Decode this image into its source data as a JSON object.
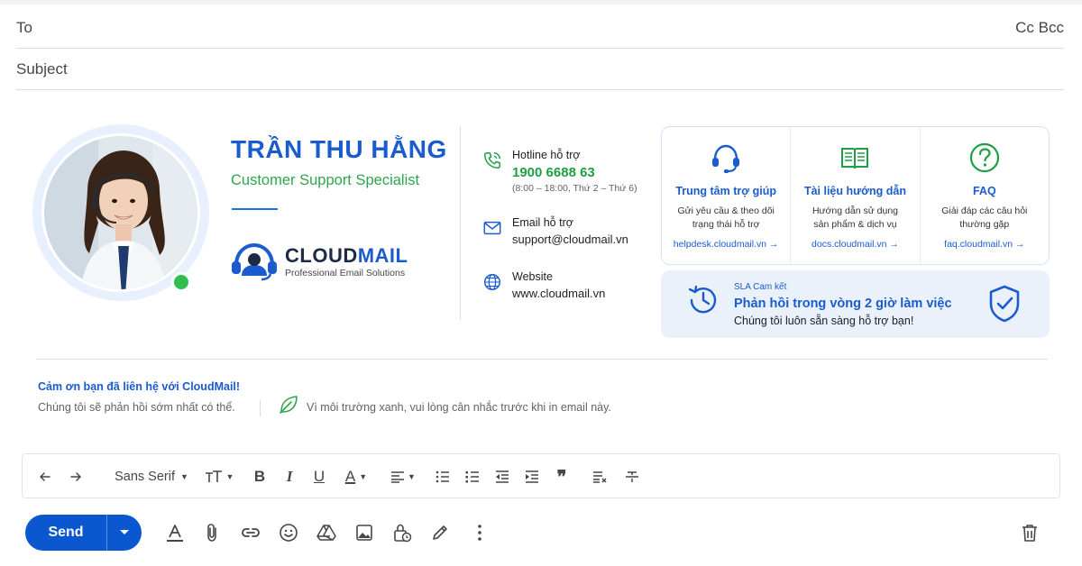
{
  "compose": {
    "to_label": "To",
    "cc_bcc_label": "Cc Bcc",
    "subject_placeholder": "Subject"
  },
  "signature": {
    "name": "TRẦN THU HẰNG",
    "role": "Customer Support Specialist",
    "brand": {
      "name_part1": "CLOUD",
      "name_part2": "MAIL",
      "tagline": "Professional Email Solutions"
    },
    "contacts": [
      {
        "label": "Hotline hỗ trợ",
        "value": "1900 6688 63",
        "sub": "(8:00 – 18:00, Thứ 2 – Thứ 6)",
        "icon": "phone-icon"
      },
      {
        "label": "Email hỗ trợ",
        "value": "support@cloudmail.vn",
        "icon": "mail-icon"
      },
      {
        "label": "Website",
        "value": "www.cloudmail.vn",
        "icon": "globe-icon"
      }
    ],
    "cards": [
      {
        "title": "Trung tâm trợ giúp",
        "desc1": "Gửi yêu cầu & theo dõi",
        "desc2": "trạng thái hỗ trợ",
        "link": "helpdesk.cloudmail.vn →",
        "icon": "headset-icon"
      },
      {
        "title": "Tài liệu hướng dẫn",
        "desc1": "Hướng dẫn sử dụng",
        "desc2": "sản phẩm & dịch vụ",
        "link": "docs.cloudmail.vn →",
        "icon": "book-icon"
      },
      {
        "title": "FAQ",
        "desc1": "Giải đáp các câu hỏi",
        "desc2": "thường gặp",
        "link": "faq.cloudmail.vn →",
        "icon": "question-icon"
      }
    ],
    "sla": {
      "kicker": "SLA Cam kết",
      "headline": "Phản hồi trong vòng 2 giờ làm việc",
      "note": "Chúng tôi luôn sẵn sàng hỗ trợ bạn!"
    },
    "footer": {
      "thanks": "Cảm ơn bạn đã liên hệ với CloudMail!",
      "reply": "Chúng tôi sẽ phản hồi sớm nhất có thể.",
      "green": "Vì môi trường xanh, vui lòng cân nhắc trước khi in email này."
    }
  },
  "toolbar": {
    "font": "Sans Serif"
  },
  "actions": {
    "send": "Send"
  },
  "colors": {
    "accent": "#1a5ccf",
    "green": "#2fa64d",
    "send": "#0b57d0"
  }
}
